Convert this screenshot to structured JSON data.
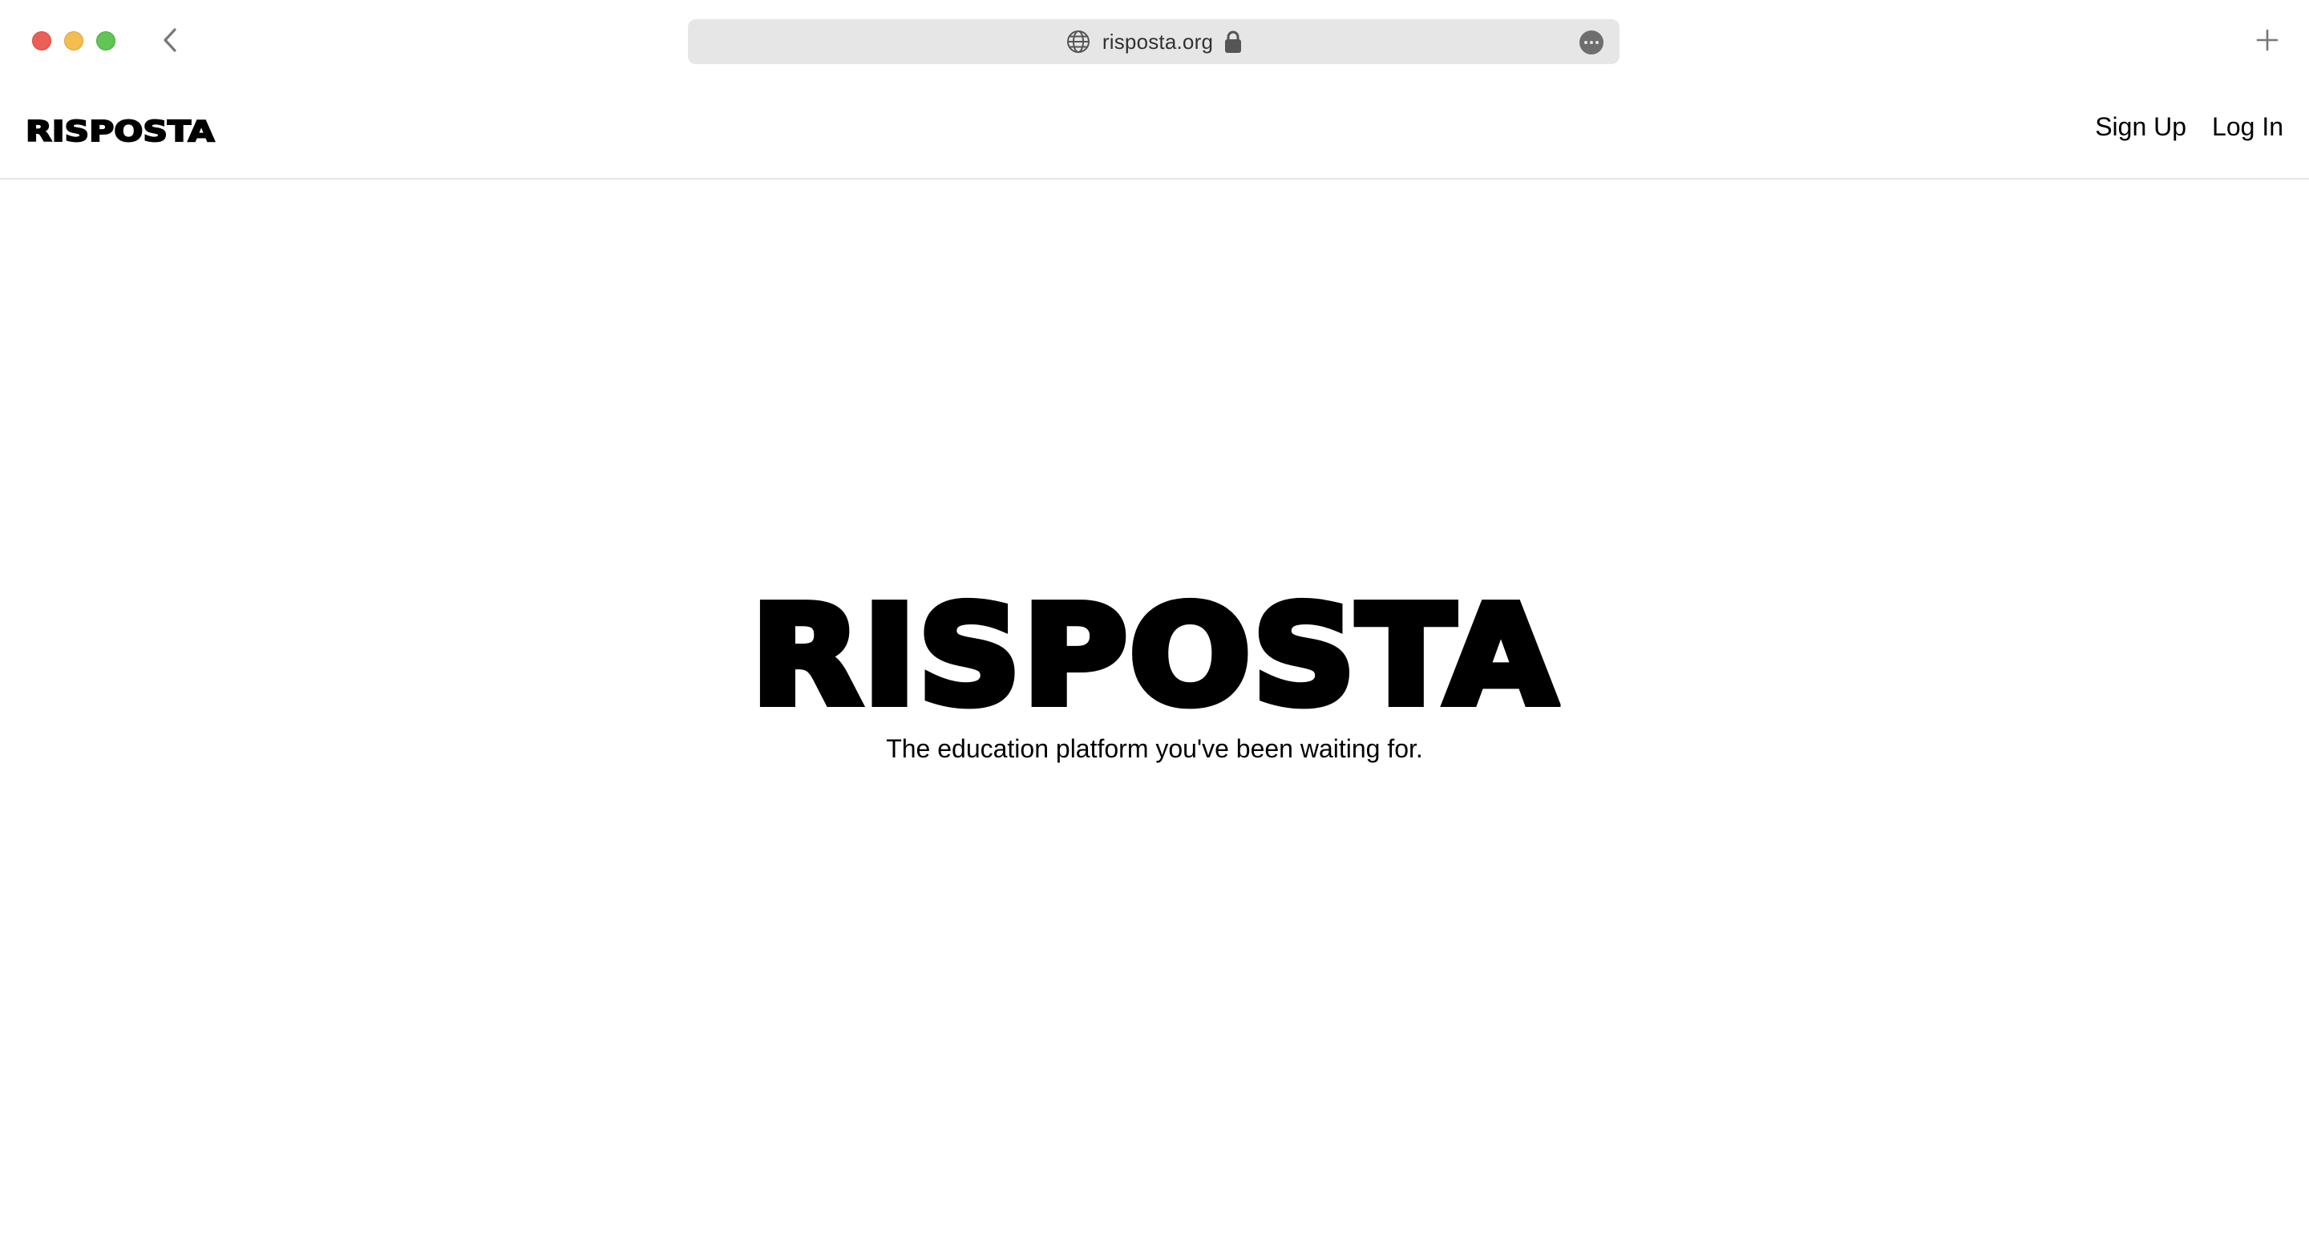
{
  "browser": {
    "url": "risposta.org",
    "icons": {
      "back": "chevron-left-icon",
      "site": "globe-icon",
      "secure": "lock-icon",
      "more": "ellipsis-circle-icon",
      "new_tab": "plus-icon"
    },
    "traffic_lights": {
      "close": "#ec5f57",
      "minimize": "#f4bd4f",
      "zoom": "#60c553"
    }
  },
  "header": {
    "brand": "RISPOSTA",
    "nav": {
      "sign_up": "Sign Up",
      "log_in": "Log In"
    }
  },
  "hero": {
    "title": "RISPOSTA",
    "subtitle": "The education platform you've been waiting for."
  }
}
